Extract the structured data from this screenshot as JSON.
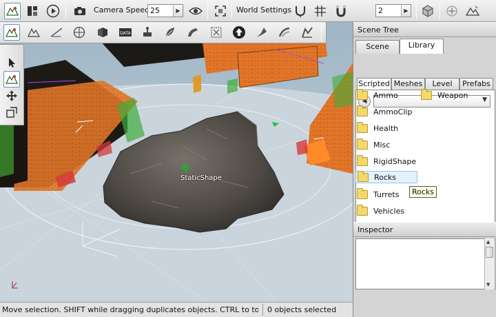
{
  "toolbar": {
    "camera_speed_label": "Camera Speed",
    "camera_speed_value": "25",
    "world_settings_label": "World Settings",
    "world_settings_value": "2",
    "icons": [
      "world-editor-icon",
      "layout-icon",
      "play-icon",
      "camera-icon",
      "visibility-eye-icon",
      "frame-selection-icon",
      "snap-icon",
      "grid-icon",
      "magnet-icon",
      "object-icon",
      "center-icon",
      "terrain-icon"
    ]
  },
  "tools": {
    "icons": [
      "object-editor-icon",
      "terrain-editor-icon",
      "terrain-painter-icon",
      "material-editor-icon",
      "sketch-tool-icon",
      "datablock-editor-icon",
      "decal-editor-icon",
      "forest-editor-icon",
      "mesh-road-editor-icon",
      "navmesh-editor-icon",
      "river-editor-icon",
      "road-editor-icon",
      "particle-editor-icon",
      "shape-editor-icon"
    ]
  },
  "gizmo_tools": [
    "select-arrow-icon",
    "move-gizmo-icon",
    "rotate-gizmo-icon",
    "scale-gizmo-icon"
  ],
  "viewport": {
    "selected_label": "StaticShape"
  },
  "status": {
    "message": "Move selection.  SHIFT while dragging duplicates objects.  CTRL to toggle sof",
    "selection_count": "0 objects selected"
  },
  "panel": {
    "title": "Scene Tree",
    "tabs": [
      "Scene",
      "Library"
    ],
    "active_tab": "Library",
    "subtabs": [
      "Scripted",
      "Meshes",
      "Level",
      "Prefabs"
    ],
    "active_subtab": "Scripted",
    "folders": [
      "Ammo",
      "Weapon",
      "AmmoClip",
      "Health",
      "Misc",
      "RigidShape",
      "Rocks",
      "Turrets",
      "Vehicles"
    ],
    "hovered_folder": "Rocks",
    "tooltip": "Rocks"
  },
  "inspector": {
    "title": "Inspector"
  }
}
